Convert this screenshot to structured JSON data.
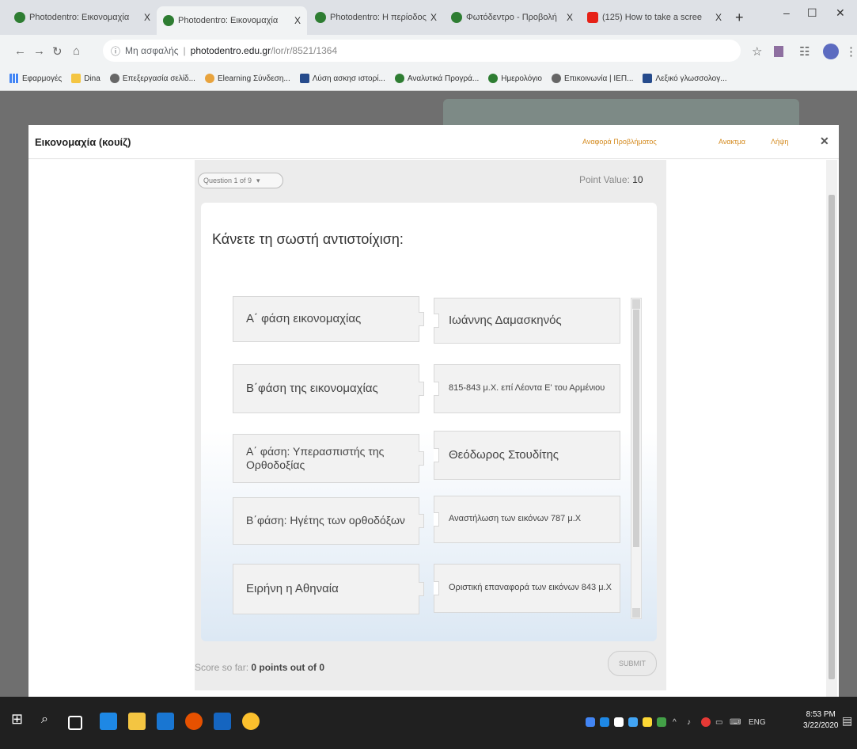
{
  "tabs": [
    {
      "label": "Photodentro: Εικονομαχία",
      "close": "X"
    },
    {
      "label": "Photodentro: Εικονομαχία",
      "close": "X"
    },
    {
      "label": "Photodentro: Η περίοδος",
      "close": "X"
    },
    {
      "label": "Φωτόδεντρο - Προβολή",
      "close": "X"
    },
    {
      "label": "(125) How to take a scree",
      "close": "X"
    }
  ],
  "new_tab": "+",
  "window_controls": {
    "minimize": "–",
    "maximize": "☐",
    "close": "✕"
  },
  "address": {
    "security": "Μη ασφαλής",
    "domain": "photodentro.edu.gr",
    "path": "/lor/r/8521/1364"
  },
  "bookmarks": [
    "Εφαρμογές",
    "Dina",
    "Επεξεργασία σελίδ...",
    "Elearning Σύνδεση...",
    "Λύση ασκησ ιστορί...",
    "Αναλυτικά Προγρά...",
    "Ημερολόγιο",
    "Επικοινωνία | ΙΕΠ...",
    "Λεξικό γλωσσολογ..."
  ],
  "modal": {
    "title": "Εικονομαχία (κουίζ)",
    "link_preview": "Αναφορά Προβλήματος",
    "link_share": "Ανακτμα",
    "link_download": "Λήψη",
    "close": "✕"
  },
  "quiz": {
    "question_select": "Question 1 of 9",
    "point_value_label": "Point Value:",
    "point_value": "10",
    "question": "Κάνετε τη σωστή αντιστοίχιση:",
    "left_items": [
      "Α΄ φάση εικονομαχίας",
      "Β΄φάση της εικονομαχίας",
      "Α΄ φάση: Υπερασπιστής της Ορθοδοξίας",
      "Β΄φάση: Ηγέτης των ορθοδόξων",
      "Ειρήνη η Αθηναία"
    ],
    "right_items": [
      "Ιωάννης Δαμασκηνός",
      "815-843 μ.Χ. επί Λέοντα Ε' του Αρμένιου",
      "Θεόδωρος Στουδίτης",
      "Αναστήλωση των εικόνων 787 μ.Χ",
      "Οριστική επαναφορά των εικόνων 843 μ.Χ"
    ],
    "score_label": "Score so far:",
    "score_value": "0 points out of 0",
    "submit": "SUBMIT"
  },
  "taskbar": {
    "lang": "ENG",
    "time": "8:53 PM",
    "date": "3/22/2020"
  }
}
